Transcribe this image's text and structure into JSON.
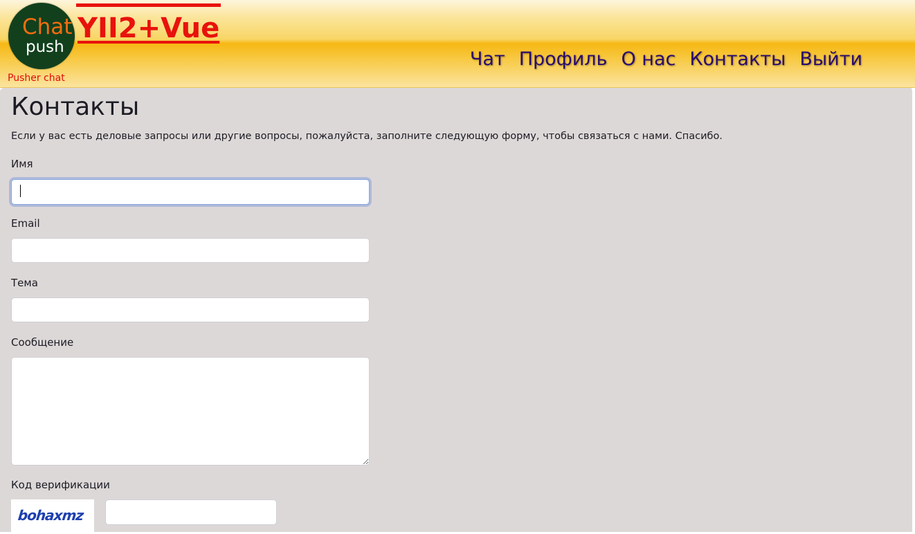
{
  "header": {
    "logo": {
      "line1": "Chat",
      "line2": "push",
      "subtitle": "Pusher chat"
    },
    "brand": "YII2+Vue",
    "nav": [
      "Чат",
      "Профиль",
      "О нас",
      "Контакты",
      "Выйти"
    ]
  },
  "main": {
    "title": "Контакты",
    "intro": "Если у вас есть деловые запросы или другие вопросы, пожалуйста, заполните следующую форму, чтобы связаться с нами. Спасибо.",
    "form": {
      "name_label": "Имя",
      "name_value": "",
      "email_label": "Email",
      "email_value": "",
      "subject_label": "Тема",
      "subject_value": "",
      "message_label": "Сообщение",
      "message_value": "",
      "verify_label": "Код верификации",
      "captcha_text": "bohaxmz",
      "verify_value": ""
    }
  },
  "colors": {
    "header_gold": "#f6b814",
    "brand_red": "#e8120c",
    "logo_green": "#12401d",
    "logo_orange": "#f26d10",
    "nav_purple": "#2a0c6e",
    "page_bg": "#ddd8d8",
    "captcha_blue": "#1d3fae"
  }
}
